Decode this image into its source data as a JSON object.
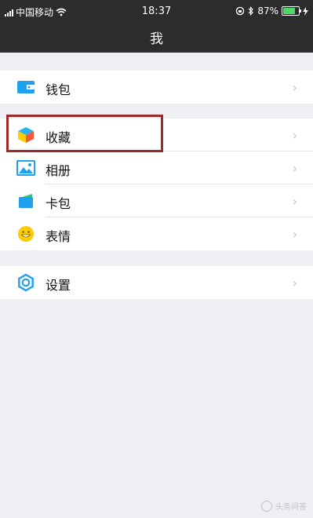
{
  "status_bar": {
    "carrier": "中国移动",
    "time": "18:37",
    "battery_percent": "87%",
    "battery_level": 0.87
  },
  "header": {
    "title": "我"
  },
  "groups": [
    {
      "items": [
        {
          "label": "钱包",
          "icon": "wallet-icon"
        }
      ]
    },
    {
      "items": [
        {
          "label": "收藏",
          "icon": "favorites-cube-icon"
        },
        {
          "label": "相册",
          "icon": "album-picture-icon"
        },
        {
          "label": "卡包",
          "icon": "card-package-icon"
        },
        {
          "label": "表情",
          "icon": "emoji-smile-icon"
        }
      ]
    },
    {
      "items": [
        {
          "label": "设置",
          "icon": "settings-gear-icon"
        }
      ]
    }
  ],
  "chevron": "›",
  "watermark": {
    "text": "头条问答"
  },
  "colors": {
    "header_bg": "#2c2c2e",
    "page_bg": "#eeeef3",
    "highlight_border": "#9b2a2a",
    "accent_blue": "#1fa0f0"
  }
}
